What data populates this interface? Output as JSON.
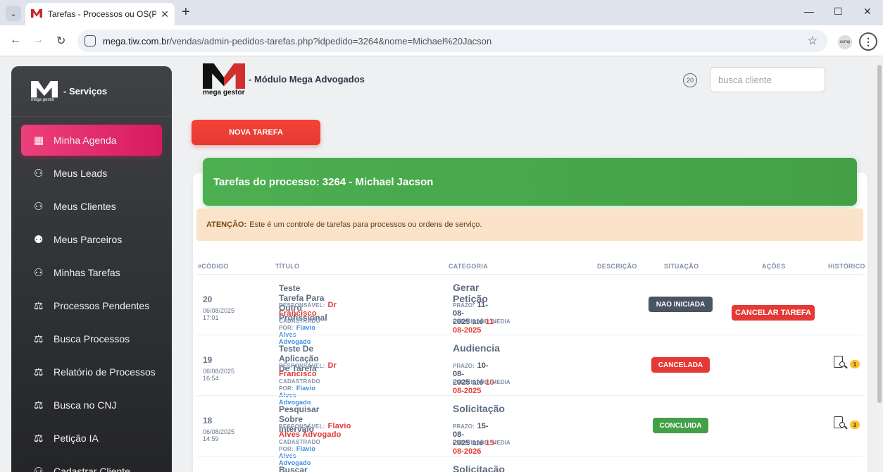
{
  "browser": {
    "tab_title": "Tarefas - Processos ou OS(Pedid",
    "url_host": "mega.tiw.com.br",
    "url_path": "/vendas/admin-pedidos-tarefas.php?idpedido=3264&nome=Michael%20Jacson",
    "ext_label": "ocmp"
  },
  "sidebar": {
    "brand_text": "- Serviços",
    "items": [
      {
        "label": "Minha Agenda",
        "icon": "calendar-icon",
        "glyph": "▦",
        "active": true
      },
      {
        "label": "Meus Leads",
        "icon": "user-gear-icon",
        "glyph": "⚇"
      },
      {
        "label": "Meus Clientes",
        "icon": "user-icon",
        "glyph": "⚇"
      },
      {
        "label": "Meus Parceiros",
        "icon": "users-icon",
        "glyph": "⚉"
      },
      {
        "label": "Minhas Tarefas",
        "icon": "user-task-icon",
        "glyph": "⚇"
      },
      {
        "label": "Processos Pendentes",
        "icon": "gavel-icon",
        "glyph": "⚖"
      },
      {
        "label": "Busca Processos",
        "icon": "gavel-icon",
        "glyph": "⚖"
      },
      {
        "label": "Relatório de Processos",
        "icon": "gavel-icon",
        "glyph": "⚖"
      },
      {
        "label": "Busca no CNJ",
        "icon": "gavel-icon",
        "glyph": "⚖"
      },
      {
        "label": "Petição IA",
        "icon": "gavel-icon",
        "glyph": "⚖"
      },
      {
        "label": "Cadastrar Cliente",
        "icon": "user-plus-icon",
        "glyph": "⚇"
      }
    ]
  },
  "header": {
    "brand_caption": "mega gestor",
    "module_title": "- Módulo Mega Advogados",
    "hdr_icon_label": "20",
    "search_placeholder": "busca cliente",
    "new_task_label": "NOVA TAREFA"
  },
  "panel": {
    "title": "Tarefas do processo: 3264 - Michael Jacson",
    "alert_strong": "ATENÇÃO:",
    "alert_text": "Este é um controle de tarefas para processos ou ordens de serviço."
  },
  "table": {
    "headers": [
      "#CÓDIGO",
      "TÍTULO",
      "CATEGORIA",
      "DESCRIÇÃO",
      "SITUAÇÃO",
      "AÇÕES",
      "HISTÓRICO"
    ],
    "lbl_resp": "RESPONSÁVEL:",
    "lbl_by": "CADASTRADO POR:",
    "lbl_prazo": "PRAZO:",
    "lbl_ate": "até",
    "lbl_prio": "PRIORIDADE:",
    "rows": [
      {
        "code": "20",
        "date": "06/08/2025 17:01",
        "title": "Teste Tarefa Para Outro Profissional",
        "responsavel": "Dr Francisco",
        "cadastrado_por": "Flavio Alves Advogado",
        "categoria": "Gerar Petição",
        "prazo_ini": "11-08-2025",
        "prazo_fim": "11-08-2025",
        "prioridade": "MEDIA",
        "situacao": "NAO INICIADA",
        "situacao_color": "#4a5463",
        "acao": "CANCELAR TAREFA",
        "historico": ""
      },
      {
        "code": "19",
        "date": "06/08/2025 16:54",
        "title": "Teste De Aplicação De Tarefa",
        "responsavel": "Dr Francisco",
        "cadastrado_por": "Flavio Alves Advogado",
        "categoria": "Audiencia",
        "prazo_ini": "10-08-2025",
        "prazo_fim": "10-08-2025",
        "prioridade": "MEDIA",
        "situacao": "CANCELADA",
        "situacao_color": "#e53935",
        "acao": "",
        "historico": "1"
      },
      {
        "code": "18",
        "date": "06/08/2025 14:59",
        "title": "Pesquisar Sobre Intervalo",
        "responsavel": "Flavio Alves Advogado",
        "cadastrado_por": "Flavio Alves Advogado",
        "categoria": "Solicitação",
        "prazo_ini": "15-08-2025",
        "prazo_fim": "15-08-2026",
        "prioridade": "MEDIA",
        "situacao": "CONCLUIDA",
        "situacao_color": "#43a047",
        "acao": "",
        "historico": "3"
      },
      {
        "title": "Buscar Documentação",
        "categoria": "Solicitação"
      }
    ]
  }
}
